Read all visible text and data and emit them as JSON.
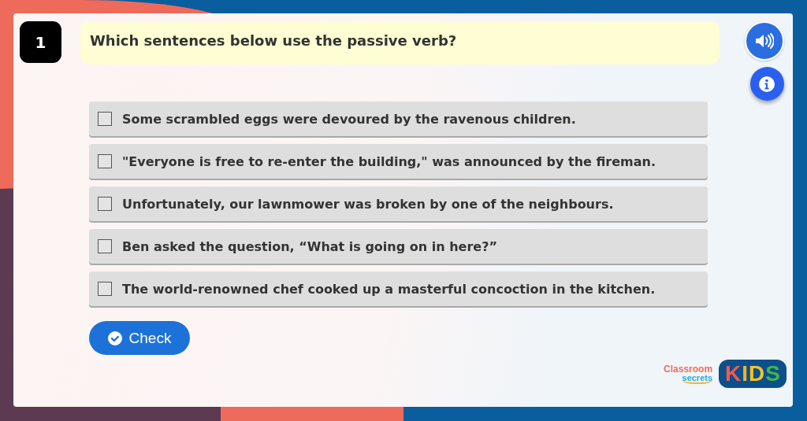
{
  "question": {
    "number": "1",
    "text": "Which sentences below use the passive verb?"
  },
  "options": [
    {
      "text": "Some scrambled eggs were devoured by the ravenous children.",
      "checked": false
    },
    {
      "text": "\"Everyone is free to re-enter the building,\" was announced by the fireman.",
      "checked": false
    },
    {
      "text": "Unfortunately, our lawnmower was broken by one of the neighbours.",
      "checked": false
    },
    {
      "text": "Ben asked the question, “What is going on in here?”",
      "checked": false
    },
    {
      "text": "The world-renowned chef cooked up a masterful concoction in the kitchen.",
      "checked": false
    }
  ],
  "check_button": {
    "label": "Check"
  },
  "logo": {
    "line_1": "Classroom",
    "line_2": "secrets",
    "badge": "KIDS"
  }
}
